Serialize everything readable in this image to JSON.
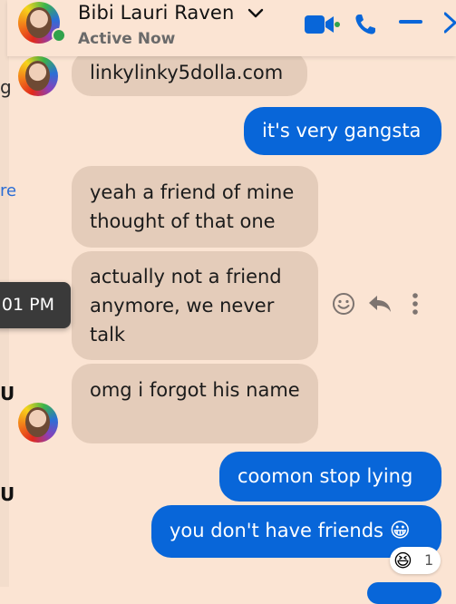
{
  "header": {
    "name": "Bibi Lauri Raven",
    "status": "Active Now"
  },
  "background_fragments": [
    "g",
    "re",
    "U",
    "U"
  ],
  "messages": [
    {
      "from": "them",
      "text": "linkylinky5dolla.com"
    },
    {
      "from": "me",
      "text": "it's very gangsta"
    },
    {
      "from": "them",
      "text": "yeah a friend of mine thought of that one"
    },
    {
      "from": "them",
      "text": "actually not a friend anymore, we never talk"
    },
    {
      "from": "them",
      "text": "omg i forgot his name"
    },
    {
      "from": "me",
      "text": "coomon stop lying"
    },
    {
      "from": "me",
      "text": "you don't have friends",
      "emoji": "😀",
      "reaction": {
        "emoji": "😆",
        "count": "1"
      }
    }
  ],
  "timestamp_tooltip": "01 PM",
  "colors": {
    "background": "#fbe4d3",
    "received_bubble": "#e4ccba",
    "sent_bubble": "#0866d9",
    "icon_blue": "#0866d9",
    "online_green": "#31a24c"
  },
  "icons": [
    "video-call-icon",
    "phone-icon",
    "minimize-icon",
    "close-icon",
    "chevron-down-icon",
    "emoji-react-icon",
    "reply-icon",
    "more-icon"
  ]
}
